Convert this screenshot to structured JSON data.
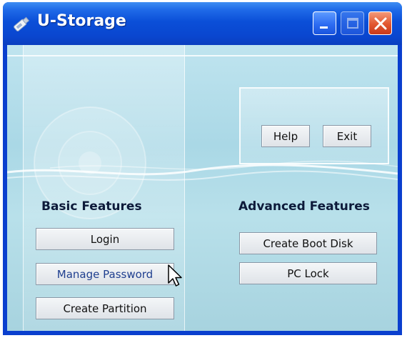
{
  "window": {
    "title": "U-Storage",
    "controls": {
      "minimize": "minimize",
      "maximize": "maximize",
      "close": "close"
    }
  },
  "basic": {
    "heading": "Basic Features",
    "buttons": [
      "Login",
      "Manage Password",
      "Create Partition"
    ]
  },
  "advanced": {
    "heading": "Advanced Features",
    "buttons": [
      "Create Boot Disk",
      "PC Lock"
    ]
  },
  "top": {
    "help_label": "Help",
    "exit_label": "Exit"
  },
  "colors": {
    "titlebar": "#0b4fd8",
    "close_button": "#e2562f",
    "client_background": "#aad8e6"
  }
}
